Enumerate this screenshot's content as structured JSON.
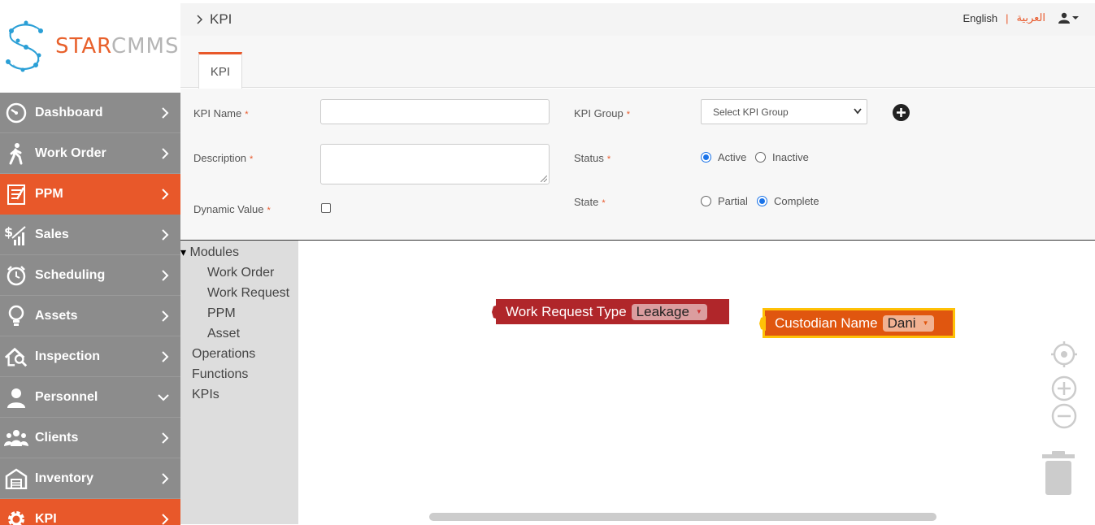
{
  "brand": {
    "part1": "STAR",
    "part2": "CMMS"
  },
  "sidebar": {
    "items": [
      {
        "label": "Dashboard",
        "icon": "dashboard-gauge-icon",
        "chevron": "right"
      },
      {
        "label": "Work Order",
        "icon": "walking-person-icon",
        "chevron": "right"
      },
      {
        "label": "PPM",
        "icon": "clipboard-icon",
        "chevron": "right"
      },
      {
        "label": "Sales",
        "icon": "sales-chart-icon",
        "chevron": "right"
      },
      {
        "label": "Scheduling",
        "icon": "alarm-clock-icon",
        "chevron": "right"
      },
      {
        "label": "Assets",
        "icon": "lightbulb-icon",
        "chevron": "right"
      },
      {
        "label": "Inspection",
        "icon": "house-search-icon",
        "chevron": "right"
      },
      {
        "label": "Personnel",
        "icon": "person-icon",
        "chevron": "down"
      },
      {
        "label": "Clients",
        "icon": "users-group-icon",
        "chevron": "right"
      },
      {
        "label": "Inventory",
        "icon": "warehouse-icon",
        "chevron": "right"
      },
      {
        "label": "KPI",
        "icon": "gear-icon",
        "chevron": "right"
      }
    ],
    "active_items": [
      "PPM",
      "KPI"
    ]
  },
  "header": {
    "breadcrumb": "KPI",
    "lang_english": "English",
    "lang_separator": "|",
    "lang_arabic": "العربية"
  },
  "tabs": [
    {
      "label": "KPI",
      "active": true
    }
  ],
  "form": {
    "kpi_name_label": "KPI Name",
    "kpi_name_value": "",
    "description_label": "Description",
    "description_value": "",
    "dynamic_value_label": "Dynamic Value",
    "dynamic_value_checked": false,
    "kpi_group_label": "KPI Group",
    "kpi_group_selected": "Select KPI Group",
    "status_label": "Status",
    "status_options": [
      "Active",
      "Inactive"
    ],
    "status_selected": "Active",
    "state_label": "State",
    "state_options": [
      "Partial",
      "Complete"
    ],
    "state_selected": "Complete",
    "required_mark": "*"
  },
  "toolbox": {
    "categories": [
      {
        "label": "Modules",
        "expanded": true,
        "children": [
          "Work Order",
          "Work Request",
          "PPM",
          "Asset"
        ]
      },
      {
        "label": "Operations"
      },
      {
        "label": "Functions"
      },
      {
        "label": "KPIs"
      }
    ],
    "expand_glyph": "▾"
  },
  "blocks": [
    {
      "label": "Work Request Type",
      "value": "Leakage",
      "color": "#b0262a"
    },
    {
      "label": "Custodian Name",
      "value": "Dani",
      "color": "#e0560f",
      "selected_outline": "#ffc107"
    }
  ],
  "colors": {
    "accent": "#e8582a",
    "sidebar": "#8c8c8c",
    "radio_checked": "#1a73e8"
  }
}
